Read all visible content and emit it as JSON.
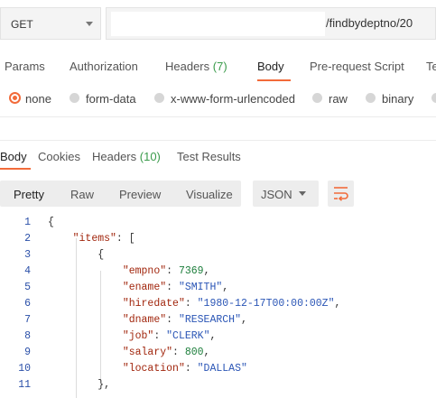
{
  "request": {
    "method": "GET",
    "url_visible": "/findbydeptno/20"
  },
  "request_tabs": [
    {
      "label": "Params",
      "count": ""
    },
    {
      "label": "Authorization",
      "count": ""
    },
    {
      "label": "Headers",
      "count": "(7)"
    },
    {
      "label": "Body",
      "count": ""
    },
    {
      "label": "Pre-request Script",
      "count": ""
    },
    {
      "label": "Te",
      "count": ""
    }
  ],
  "active_request_tab": "Body",
  "body_types": [
    "none",
    "form-data",
    "x-www-form-urlencoded",
    "raw",
    "binary"
  ],
  "selected_body_type": "none",
  "response_tabs": [
    {
      "label": "Body",
      "count": ""
    },
    {
      "label": "Cookies",
      "count": ""
    },
    {
      "label": "Headers",
      "count": "(10)"
    },
    {
      "label": "Test Results",
      "count": ""
    }
  ],
  "active_response_tab": "Body",
  "view_modes": [
    "Pretty",
    "Raw",
    "Preview",
    "Visualize"
  ],
  "active_view_mode": "Pretty",
  "format": "JSON",
  "colors": {
    "accent": "#f26b3a",
    "count_green": "#3a9b4b",
    "line_number": "#2a4fa8",
    "json_key": "#a1260d",
    "json_string": "#2b56b6",
    "json_number": "#1b7d3a"
  },
  "icons": {
    "method_dropdown": "chevron-down-icon",
    "format_dropdown": "chevron-down-icon",
    "wrap": "wrap-lines-icon"
  },
  "code_lines": [
    {
      "n": "1",
      "parts": [
        {
          "t": "{",
          "c": "p"
        }
      ]
    },
    {
      "n": "2",
      "parts": [
        {
          "t": "    ",
          "c": "p"
        },
        {
          "t": "\"items\"",
          "c": "key"
        },
        {
          "t": ": [",
          "c": "p"
        }
      ]
    },
    {
      "n": "3",
      "parts": [
        {
          "t": "        {",
          "c": "p"
        }
      ]
    },
    {
      "n": "4",
      "parts": [
        {
          "t": "            ",
          "c": "p"
        },
        {
          "t": "\"empno\"",
          "c": "key"
        },
        {
          "t": ": ",
          "c": "p"
        },
        {
          "t": "7369",
          "c": "num"
        },
        {
          "t": ",",
          "c": "p"
        }
      ]
    },
    {
      "n": "5",
      "parts": [
        {
          "t": "            ",
          "c": "p"
        },
        {
          "t": "\"ename\"",
          "c": "key"
        },
        {
          "t": ": ",
          "c": "p"
        },
        {
          "t": "\"SMITH\"",
          "c": "str"
        },
        {
          "t": ",",
          "c": "p"
        }
      ]
    },
    {
      "n": "6",
      "parts": [
        {
          "t": "            ",
          "c": "p"
        },
        {
          "t": "\"hiredate\"",
          "c": "key"
        },
        {
          "t": ": ",
          "c": "p"
        },
        {
          "t": "\"1980-12-17T00:00:00Z\"",
          "c": "str"
        },
        {
          "t": ",",
          "c": "p"
        }
      ]
    },
    {
      "n": "7",
      "parts": [
        {
          "t": "            ",
          "c": "p"
        },
        {
          "t": "\"dname\"",
          "c": "key"
        },
        {
          "t": ": ",
          "c": "p"
        },
        {
          "t": "\"RESEARCH\"",
          "c": "str"
        },
        {
          "t": ",",
          "c": "p"
        }
      ]
    },
    {
      "n": "8",
      "parts": [
        {
          "t": "            ",
          "c": "p"
        },
        {
          "t": "\"job\"",
          "c": "key"
        },
        {
          "t": ": ",
          "c": "p"
        },
        {
          "t": "\"CLERK\"",
          "c": "str"
        },
        {
          "t": ",",
          "c": "p"
        }
      ]
    },
    {
      "n": "9",
      "parts": [
        {
          "t": "            ",
          "c": "p"
        },
        {
          "t": "\"salary\"",
          "c": "key"
        },
        {
          "t": ": ",
          "c": "p"
        },
        {
          "t": "800",
          "c": "num"
        },
        {
          "t": ",",
          "c": "p"
        }
      ]
    },
    {
      "n": "10",
      "parts": [
        {
          "t": "            ",
          "c": "p"
        },
        {
          "t": "\"location\"",
          "c": "key"
        },
        {
          "t": ": ",
          "c": "p"
        },
        {
          "t": "\"DALLAS\"",
          "c": "str"
        }
      ]
    },
    {
      "n": "11",
      "parts": [
        {
          "t": "        },",
          "c": "p"
        }
      ]
    }
  ]
}
